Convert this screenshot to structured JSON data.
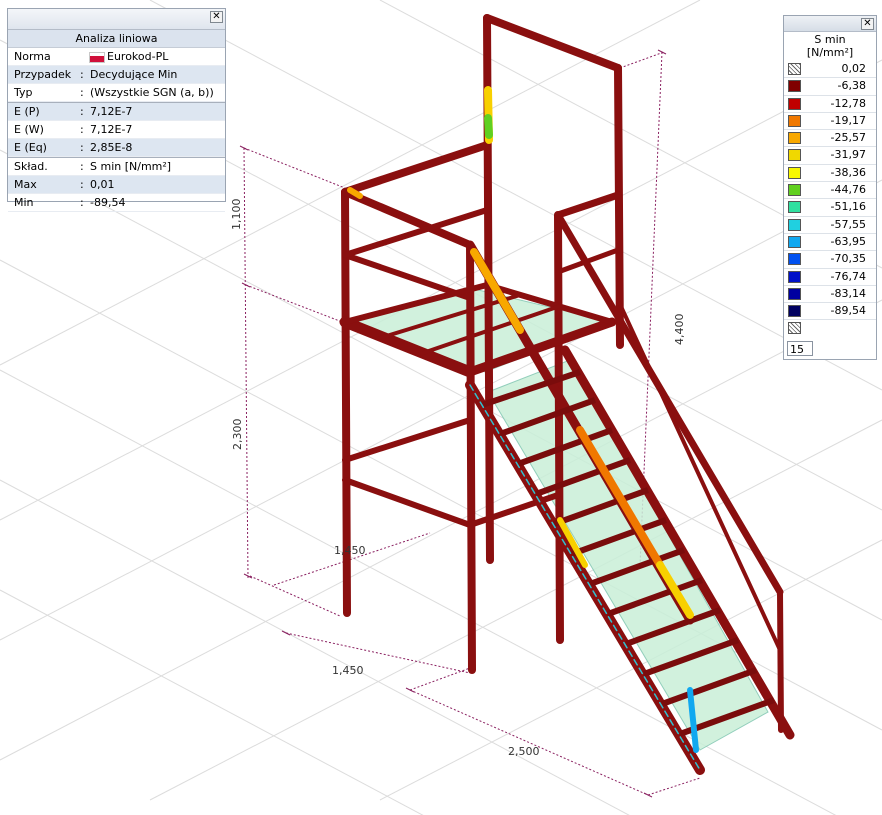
{
  "info_panel": {
    "title": "Analiza liniowa",
    "rows": [
      {
        "label": "Norma",
        "value": "Eurokod-PL"
      },
      {
        "label": "Przypadek",
        "value": "Decydujące Min"
      },
      {
        "label": "Typ",
        "value": "(Wszystkie SGN (a, b))"
      },
      {
        "label": "E (P)",
        "value": "7,12E-7"
      },
      {
        "label": "E (W)",
        "value": "7,12E-7"
      },
      {
        "label": "E (Eq)",
        "value": "2,85E-8"
      },
      {
        "label": "Skład.",
        "value": "S min [N/mm²]"
      },
      {
        "label": "Max",
        "value": "0,01"
      },
      {
        "label": "Min",
        "value": "-89,54"
      }
    ],
    "close_glyph": "✕"
  },
  "legend": {
    "title_line1": "S min",
    "title_line2": "[N/mm²]",
    "close_glyph": "✕",
    "top_value": "0,02",
    "steps": [
      {
        "value": "-6,38",
        "color": "#800000"
      },
      {
        "value": "-12,78",
        "color": "#c00000"
      },
      {
        "value": "-19,17",
        "color": "#f07800"
      },
      {
        "value": "-25,57",
        "color": "#f8a800"
      },
      {
        "value": "-31,97",
        "color": "#f0d800"
      },
      {
        "value": "-38,36",
        "color": "#f8f800"
      },
      {
        "value": "-44,76",
        "color": "#60d020"
      },
      {
        "value": "-51,16",
        "color": "#30e0a0"
      },
      {
        "value": "-57,55",
        "color": "#20d0e0"
      },
      {
        "value": "-63,95",
        "color": "#10a8f0"
      },
      {
        "value": "-70,35",
        "color": "#0050f0"
      },
      {
        "value": "-76,74",
        "color": "#0010c8"
      },
      {
        "value": "-83,14",
        "color": "#0000a0"
      },
      {
        "value": "-89,54",
        "color": "#000060"
      }
    ],
    "count": "15"
  },
  "dimensions": {
    "height_top": "1,100",
    "height_bottom": "2,300",
    "height_total": "4,400",
    "depth": "1,450",
    "width": "1,450",
    "stair_length": "2,500"
  },
  "colors": {
    "member": "#8a0f0f",
    "member_light": "#b01818",
    "dimension": "#8a2060",
    "grid": "#d8d8d8",
    "glass": "#c9efd8"
  }
}
